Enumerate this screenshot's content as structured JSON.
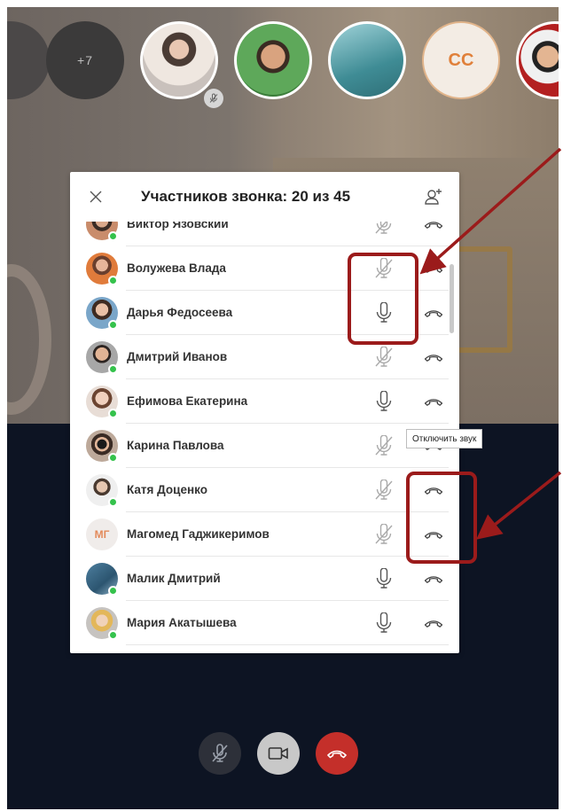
{
  "call": {
    "more_participants": "+7",
    "initials_avatar": "CC"
  },
  "panel": {
    "title": "Участников звонка: 20 из 45"
  },
  "participants": [
    {
      "name": "Виктор Язовский",
      "mic": "muted",
      "online": true,
      "avatar": "photo"
    },
    {
      "name": "Волужева Влада",
      "mic": "muted",
      "online": true,
      "avatar": "photo"
    },
    {
      "name": "Дарья Федосеева",
      "mic": "on",
      "online": true,
      "avatar": "photo"
    },
    {
      "name": "Дмитрий Иванов",
      "mic": "muted",
      "online": true,
      "avatar": "photo"
    },
    {
      "name": "Ефимова Екатерина",
      "mic": "on",
      "online": true,
      "avatar": "photo"
    },
    {
      "name": "Карина Павлова",
      "mic": "muted",
      "online": true,
      "avatar": "photo"
    },
    {
      "name": "Катя Доценко",
      "mic": "muted",
      "online": true,
      "avatar": "photo"
    },
    {
      "name": "Магомед Гаджикеримов",
      "mic": "muted",
      "online": false,
      "avatar": "МГ"
    },
    {
      "name": "Малик Дмитрий",
      "mic": "on",
      "online": true,
      "avatar": "photo"
    },
    {
      "name": "Мария Акатышева",
      "mic": "on",
      "online": true,
      "avatar": "photo"
    }
  ],
  "tooltip": {
    "text": "Отключить звук"
  },
  "colors": {
    "highlight": "#9b1b1b",
    "online": "#35c24c",
    "end_call": "#c42f2a"
  }
}
